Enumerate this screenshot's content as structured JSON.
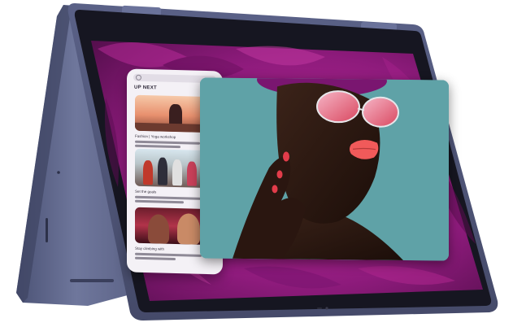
{
  "panel": {
    "heading": "UP NEXT",
    "items": [
      {
        "title": "Fashion | Yoga workshop"
      },
      {
        "title": "Set the goals"
      },
      {
        "title": "Stay climbing with"
      }
    ]
  },
  "colors": {
    "chassis": "#5b6285",
    "bezel": "#161621",
    "wallpaper": "#8b1a78",
    "video_bg": "#5fa2a7",
    "lips": "#f15a5a"
  }
}
